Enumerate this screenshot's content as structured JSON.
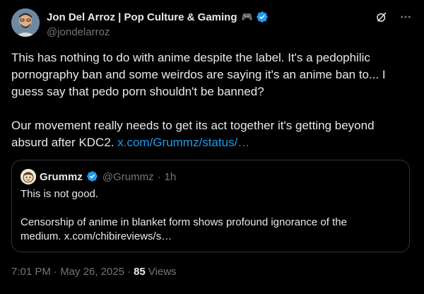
{
  "post": {
    "author": {
      "display_name": "Jon Del Arroz | Pop Culture & Gaming",
      "handle": "@jondelarroz",
      "name_emoji": "🎮",
      "verified": true
    },
    "body_text": "This has nothing to do with anime despite the label. It's a pedophilic pornography ban and some weirdos are saying it's an anime ban to... I guess say that pedo porn shouldn't be banned?\n\nOur movement really needs to get its act together it's getting beyond absurd after KDC2. ",
    "body_link": "x.com/Grummz/status/…",
    "time": "7:01 PM · May 26, 2025",
    "views_count": "85",
    "views_label": "Views"
  },
  "quote": {
    "author": {
      "display_name": "Grummz",
      "handle": "@Grummz",
      "separator": "·",
      "time": "1h",
      "verified": true
    },
    "text": "This is not good.\n\nCensorship of anime in blanket form shows profound ignorance of the medium. ",
    "link": "x.com/chibireviews/s…"
  },
  "colors": {
    "background": "#000000",
    "text": "#e7e9ea",
    "secondary": "#71767b",
    "link": "#1d9bf0",
    "verified": "#1d9bf0",
    "border": "#2f3336"
  },
  "icons": {
    "grok": "grok-icon",
    "more": "more-icon",
    "verified": "verified-badge-icon"
  }
}
